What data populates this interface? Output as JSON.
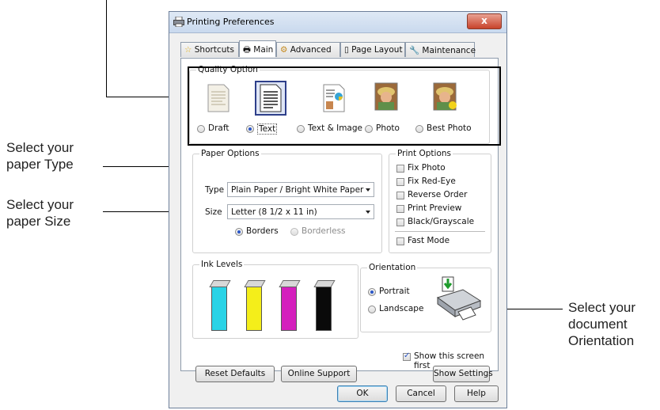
{
  "callouts": {
    "type_line1": "Select your",
    "type_line2_prefix": "paper ",
    "type_line2_word": "Type",
    "size_line1": "Select your",
    "size_line2_prefix": "paper ",
    "size_line2_word": "Size",
    "orient_line1": "Select your",
    "orient_line2": "document",
    "orient_line3": "Orientation"
  },
  "window": {
    "title": "Printing Preferences",
    "close_label": "x"
  },
  "tabs": [
    {
      "label": "Shortcuts"
    },
    {
      "label": "Main"
    },
    {
      "label": "Advanced"
    },
    {
      "label": "Page Layout"
    },
    {
      "label": "Maintenance"
    }
  ],
  "quality": {
    "legend": "Quality Option",
    "options": [
      {
        "label": "Draft",
        "selected": false
      },
      {
        "label": "Text",
        "selected": true
      },
      {
        "label": "Text & Image",
        "selected": false
      },
      {
        "label": "Photo",
        "selected": false
      },
      {
        "label": "Best Photo",
        "selected": false
      }
    ]
  },
  "paper": {
    "legend": "Paper Options",
    "type_label": "Type",
    "type_value": "Plain Paper / Bright White Paper",
    "size_label": "Size",
    "size_value": "Letter (8 1/2 x 11 in)",
    "borders_label": "Borders",
    "borderless_label": "Borderless"
  },
  "print_options": {
    "legend": "Print Options",
    "items": [
      {
        "label": "Fix Photo",
        "checked": false
      },
      {
        "label": "Fix Red-Eye",
        "checked": false
      },
      {
        "label": "Reverse Order",
        "checked": false
      },
      {
        "label": "Print Preview",
        "checked": false
      },
      {
        "label": "Black/Grayscale",
        "checked": false
      },
      {
        "label": "Fast Mode",
        "checked": false
      }
    ]
  },
  "ink": {
    "legend": "Ink Levels",
    "colors": [
      "#29d3e6",
      "#f4ee1a",
      "#d41fbd",
      "#0a0a0a"
    ]
  },
  "orientation": {
    "legend": "Orientation",
    "portrait_label": "Portrait",
    "landscape_label": "Landscape"
  },
  "footer": {
    "show_first_label": "Show this screen first",
    "reset_label": "Reset Defaults",
    "support_label": "Online Support",
    "settings_label": "Show Settings",
    "ok_label": "OK",
    "cancel_label": "Cancel",
    "help_label": "Help"
  }
}
